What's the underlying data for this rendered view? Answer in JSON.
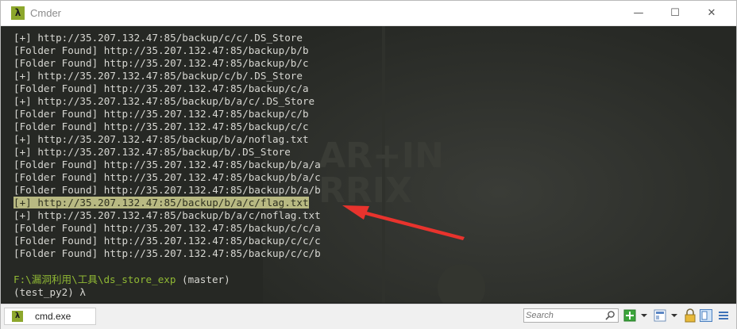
{
  "window": {
    "title": "Cmder",
    "app_icon_glyph": "λ",
    "controls": {
      "minimize": "—",
      "maximize": "☐",
      "close": "✕"
    }
  },
  "terminal": {
    "lines": [
      "[+] http://35.207.132.47:85/backup/c/c/.DS_Store",
      "[Folder Found] http://35.207.132.47:85/backup/b/b",
      "[Folder Found] http://35.207.132.47:85/backup/b/c",
      "[+] http://35.207.132.47:85/backup/c/b/.DS_Store",
      "[Folder Found] http://35.207.132.47:85/backup/c/a",
      "[+] http://35.207.132.47:85/backup/b/a/c/.DS_Store",
      "[Folder Found] http://35.207.132.47:85/backup/c/b",
      "[Folder Found] http://35.207.132.47:85/backup/c/c",
      "[+] http://35.207.132.47:85/backup/b/a/noflag.txt",
      "[+] http://35.207.132.47:85/backup/b/.DS_Store",
      "[Folder Found] http://35.207.132.47:85/backup/b/a/a",
      "[Folder Found] http://35.207.132.47:85/backup/b/a/c",
      "[Folder Found] http://35.207.132.47:85/backup/b/a/b",
      "[+] http://35.207.132.47:85/backup/b/a/c/flag.txt",
      "[+] http://35.207.132.47:85/backup/b/a/c/noflag.txt",
      "[Folder Found] http://35.207.132.47:85/backup/c/c/a",
      "[Folder Found] http://35.207.132.47:85/backup/c/c/c",
      "[Folder Found] http://35.207.132.47:85/backup/c/c/b"
    ],
    "highlighted_line": 13,
    "prompt_path": "F:\\漏洞利用\\工具\\ds_store_exp",
    "prompt_branch": " (master)",
    "prompt_env": "(test_py2) λ"
  },
  "bottom": {
    "tab_icon_glyph": "λ",
    "tab_label": "cmd.exe",
    "search_placeholder": "Search"
  },
  "colors": {
    "console_bg": "#262824",
    "text": "#d7d7d2",
    "prompt_path": "#90b934",
    "highlight_bg": "#b8b982",
    "arrow": "#e8332d"
  },
  "icons": [
    "lambda-icon",
    "minimize-icon",
    "maximize-icon",
    "close-icon",
    "search-icon",
    "new-tab-icon",
    "layout-icon",
    "lock-icon",
    "split-view-icon",
    "menu-icon"
  ]
}
